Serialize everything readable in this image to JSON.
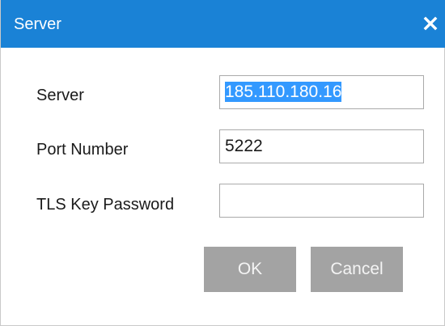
{
  "dialog": {
    "title": "Server",
    "close_icon": "close-icon"
  },
  "form": {
    "server": {
      "label": "Server",
      "value": "185.110.180.16",
      "selected": true
    },
    "port": {
      "label": "Port Number",
      "value": "5222"
    },
    "tls_password": {
      "label": "TLS Key Password",
      "value": ""
    }
  },
  "buttons": {
    "ok_label": "OK",
    "cancel_label": "Cancel"
  },
  "colors": {
    "titlebar": "#1a82d6",
    "button": "#a3a3a3",
    "selection": "#3399ff"
  }
}
